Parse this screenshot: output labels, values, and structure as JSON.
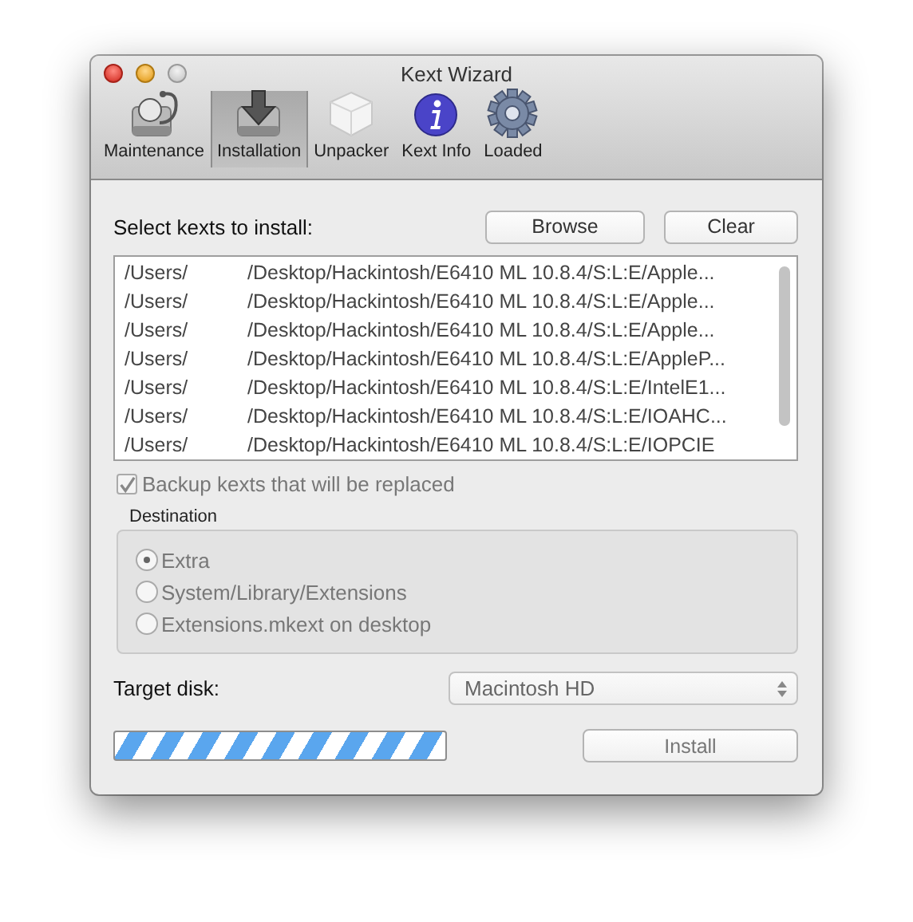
{
  "window": {
    "title": "Kext Wizard"
  },
  "toolbar": [
    {
      "label": "Maintenance",
      "kind": "stethoscope",
      "selected": false
    },
    {
      "label": "Installation",
      "kind": "install",
      "selected": true
    },
    {
      "label": "Unpacker",
      "kind": "cube",
      "selected": false
    },
    {
      "label": "Kext Info",
      "kind": "info",
      "selected": false
    },
    {
      "label": "Loaded",
      "kind": "gear",
      "selected": false
    }
  ],
  "select_label": "Select kexts to install:",
  "buttons": [
    {
      "label": "Browse",
      "disabled": false
    },
    {
      "label": "Clear",
      "disabled": false
    }
  ],
  "files": [
    {
      "column_1": "/Users/",
      "column_2": "/Desktop/Hackintosh/E6410 ML 10.8.4/S:L:E/Apple..."
    },
    {
      "column_1": "/Users/",
      "column_2": "/Desktop/Hackintosh/E6410 ML 10.8.4/S:L:E/Apple..."
    },
    {
      "column_1": "/Users/",
      "column_2": "/Desktop/Hackintosh/E6410 ML 10.8.4/S:L:E/Apple..."
    },
    {
      "column_1": "/Users/",
      "column_2": "/Desktop/Hackintosh/E6410 ML 10.8.4/S:L:E/AppleP..."
    },
    {
      "column_1": "/Users/",
      "column_2": "/Desktop/Hackintosh/E6410 ML 10.8.4/S:L:E/IntelE1..."
    },
    {
      "column_1": "/Users/",
      "column_2": "/Desktop/Hackintosh/E6410 ML 10.8.4/S:L:E/IOAHC..."
    },
    {
      "column_1": "/Users/",
      "column_2": "/Desktop/Hackintosh/E6410 ML 10.8.4/S:L:E/IOPCIE"
    }
  ],
  "backup": {
    "label": "Backup kexts that will be replaced",
    "checked": true,
    "disabled": true
  },
  "destination": {
    "title": "Destination",
    "disabled": true,
    "options": [
      {
        "label": "Extra",
        "selected": true
      },
      {
        "label": "System/Library/Extensions",
        "selected": false
      },
      {
        "label": "Extensions.mkext on desktop",
        "selected": false
      }
    ]
  },
  "target_disk": {
    "label": "Target disk:",
    "value": "Macintosh HD",
    "disabled": true
  },
  "progress": {
    "indeterminate": true
  },
  "install": {
    "label": "Install",
    "disabled": true
  }
}
